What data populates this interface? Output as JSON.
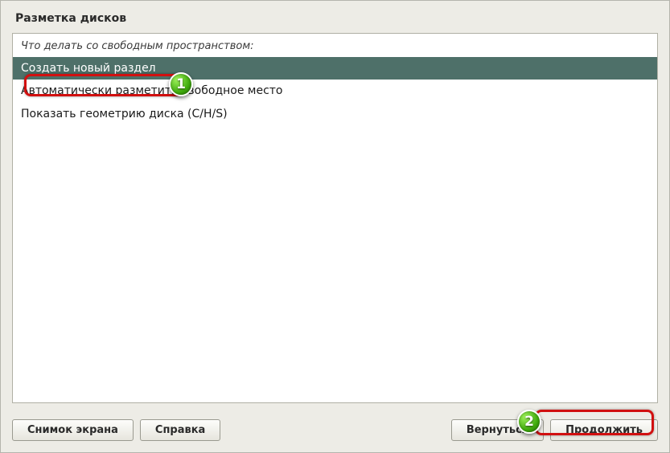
{
  "title": "Разметка дисков",
  "prompt": "Что делать со свободным пространством:",
  "options": [
    {
      "label": "Создать новый раздел",
      "selected": true
    },
    {
      "label": "Автоматически разметить свободное место",
      "selected": false
    },
    {
      "label": "Показать геометрию диска (C/H/S)",
      "selected": false
    }
  ],
  "buttons": {
    "screenshot": "Снимок экрана",
    "help": "Справка",
    "back": "Вернуться",
    "continue": "Продолжить"
  },
  "callouts": {
    "one": "1",
    "two": "2"
  }
}
